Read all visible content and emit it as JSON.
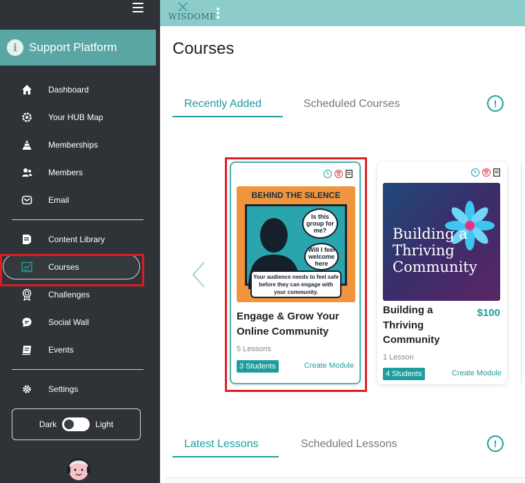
{
  "sidebar": {
    "brand": "Support Platform",
    "items": [
      {
        "label": "Dashboard",
        "icon": "home-icon"
      },
      {
        "label": "Your HUB Map",
        "icon": "gear-icon"
      },
      {
        "label": "Memberships",
        "icon": "pyramid-icon"
      },
      {
        "label": "Members",
        "icon": "users-icon"
      },
      {
        "label": "Email",
        "icon": "mail-icon"
      }
    ],
    "items2": [
      {
        "label": "Content Library",
        "icon": "document-icon"
      },
      {
        "label": "Courses",
        "icon": "course-icon"
      },
      {
        "label": "Challenges",
        "icon": "badge-icon"
      },
      {
        "label": "Social Wall",
        "icon": "chat-icon"
      },
      {
        "label": "Events",
        "icon": "calendar-icon"
      }
    ],
    "settings": "Settings",
    "theme": {
      "dark": "Dark",
      "light": "Light"
    }
  },
  "topbar": {
    "logo": "WISDOME"
  },
  "main": {
    "title": "Courses",
    "tabs": [
      "Recently Added",
      "Scheduled Courses"
    ],
    "lesson_tabs": [
      "Latest Lessons",
      "Scheduled Lessons"
    ],
    "info": "!"
  },
  "courses": [
    {
      "title": "Engage & Grow Your Online Community",
      "lessons": "5 Lessons",
      "students": "3 Students",
      "create": "Create Module",
      "poster": {
        "heading": "BEHIND THE SILENCE",
        "bubble1": "Is this group for me?",
        "bubble2": "Will I feel welcome here",
        "note": "Your audience needs to feel safe before they can engage with your community."
      }
    },
    {
      "title": "Building a Thriving Community",
      "price": "$100",
      "lessons": "1 Lesson",
      "students": "4 Students",
      "create": "Create Module",
      "poster": {
        "text": "Building a Thriving Community"
      }
    }
  ],
  "colors": {
    "accent": "#1f9c9c",
    "sidebar": "#2f3337",
    "topbar": "#8ccdcb",
    "highlight": "#e11b22"
  }
}
